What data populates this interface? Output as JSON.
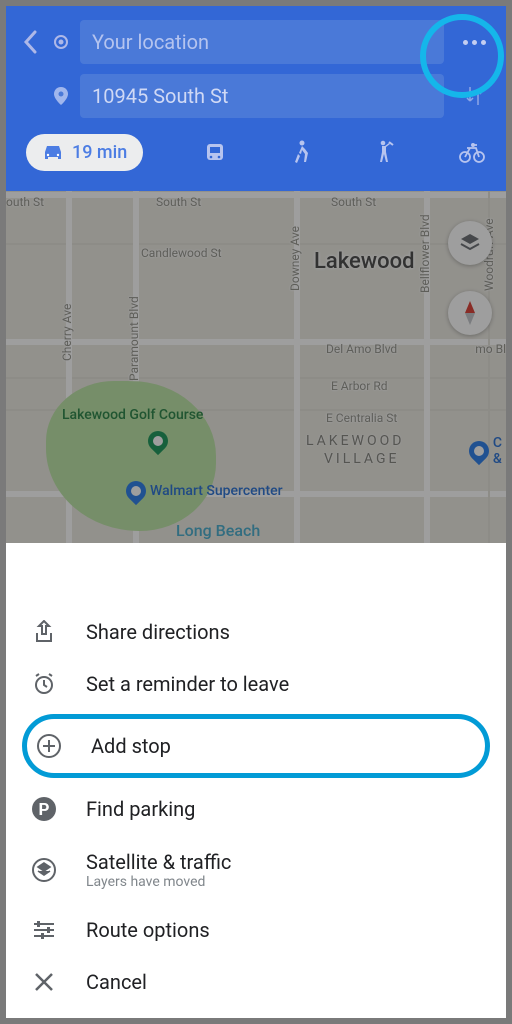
{
  "header": {
    "origin_placeholder": "Your location",
    "destination_value": "10945 South St"
  },
  "modes": {
    "drive_label": "19 min"
  },
  "map": {
    "city": "Lakewood",
    "district1": "LAKEWOOD",
    "district2": "VILLAGE",
    "golf": "Lakewood Golf Course",
    "walmart": "Walmart Supercenter",
    "longbeach": "Long Beach",
    "costco": "C\n&",
    "streets": {
      "south1": "outh St",
      "south2": "South St",
      "south3": "South St",
      "candlewood": "Candlewood St",
      "delamo": "Del Amo Blvd",
      "delamo2": "mo Bl",
      "arbor": "E Arbor Rd",
      "centralia": "E Centralia St",
      "cherry": "Cherry Ave",
      "paramount": "Paramount Blvd",
      "downey": "Downey Ave",
      "bellflower": "Bellflower Blvd",
      "woodruff": "Woodruff Ave"
    }
  },
  "menu": {
    "share": "Share directions",
    "reminder": "Set a reminder to leave",
    "addstop": "Add stop",
    "parking": "Find parking",
    "satellite": "Satellite & traffic",
    "satellite_sub": "Layers have moved",
    "route": "Route options",
    "cancel": "Cancel"
  }
}
